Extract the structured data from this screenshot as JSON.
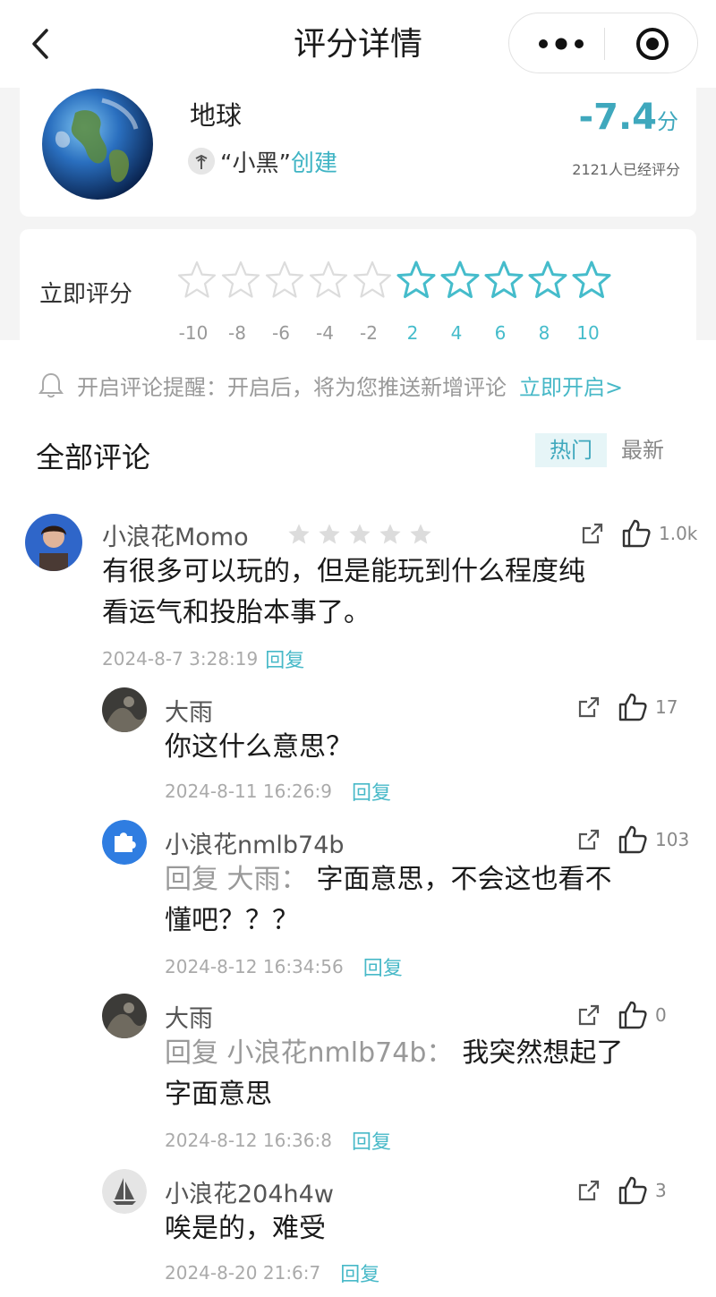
{
  "header": {
    "title": "评分详情"
  },
  "item": {
    "name": "地球",
    "creator_name": "“小黑”",
    "creator_verb": "创建",
    "score": "-7.4",
    "score_unit": "分",
    "raters": "2121人已经评分"
  },
  "rate": {
    "label": "立即评分",
    "scale": [
      "-10",
      "-8",
      "-6",
      "-4",
      "-2",
      "2",
      "4",
      "6",
      "8",
      "10"
    ],
    "colors": {
      "inactive": "#dcdcdc",
      "active": "#45bccb"
    }
  },
  "notice": {
    "text": "开启评论提醒：开启后，将为您推送新增评论",
    "link": "立即开启>"
  },
  "comments_header": {
    "title": "全部评论",
    "tab_hot": "热门",
    "tab_new": "最新"
  },
  "comments": [
    {
      "user": "小浪花Momo",
      "text_line1": "有很多可以玩的，但是能玩到什么程度纯",
      "text_line2": "看运气和投胎本事了。",
      "time": "2024-8-7 3:28:19",
      "reply": "回复",
      "likes": "1.0k",
      "avatar_icon": "person-photo-icon"
    },
    {
      "user": "大雨",
      "text_line1": "你这什么意思？",
      "time": "2024-8-11 16:26:9",
      "reply": "回复",
      "likes": "17",
      "avatar_icon": "dark-photo-icon"
    },
    {
      "user": "小浪花nmlb74b",
      "reply_prefix": "回复 大雨：",
      "text_line1": "字面意思，不会这也看不",
      "text_line2": "懂吧？？？",
      "time": "2024-8-12 16:34:56",
      "reply": "回复",
      "likes": "103",
      "avatar_icon": "puzzle-icon"
    },
    {
      "user": "大雨",
      "reply_prefix": "回复 小浪花nmlb74b：",
      "text_line1": "我突然想起了",
      "text_line2": "字面意思",
      "time": "2024-8-12 16:36:8",
      "reply": "回复",
      "likes": "0",
      "avatar_icon": "dark-photo-icon"
    },
    {
      "user": "小浪花204h4w",
      "text_line1": "唉是的，难受",
      "time": "2024-8-20 21:6:7",
      "reply": "回复",
      "likes": "3",
      "avatar_icon": "sailboat-icon"
    }
  ]
}
